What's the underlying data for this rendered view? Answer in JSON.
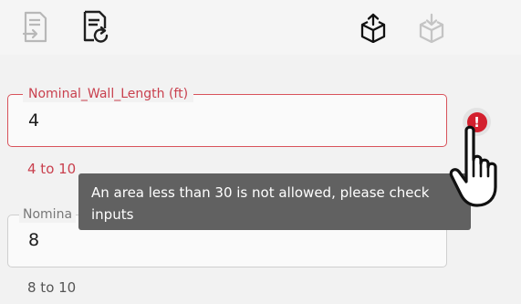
{
  "toolbar": {
    "icons": [
      "document-export-icon",
      "document-refresh-icon",
      "box-export-icon",
      "box-import-icon"
    ]
  },
  "fields": [
    {
      "label": "Nominal_Wall_Length (ft)",
      "value": "4",
      "helper": "4 to 10",
      "state": "error"
    },
    {
      "label": "Nomina",
      "value": "8",
      "helper": "8 to 10",
      "state": "normal"
    }
  ],
  "error_badge": {
    "glyph": "!",
    "color": "#d3202e"
  },
  "tooltip": {
    "line1": "An area less than 30 is not allowed, please check",
    "line2": "inputs"
  },
  "colors": {
    "error": "#c9404e",
    "tooltip_bg": "#616161"
  }
}
